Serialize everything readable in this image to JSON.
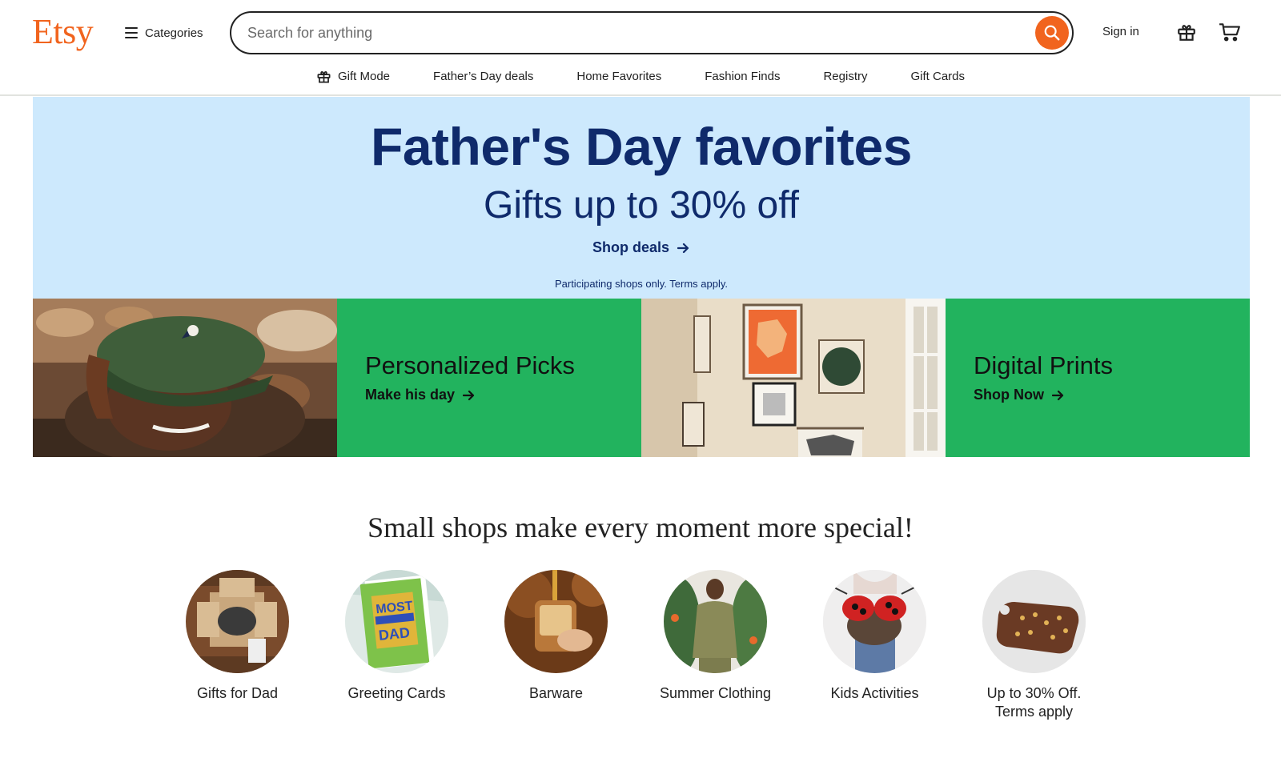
{
  "header": {
    "logo": "Etsy",
    "categories_label": "Categories",
    "search_placeholder": "Search for anything",
    "signin_label": "Sign in",
    "icons": [
      "menu-icon",
      "search-icon",
      "gift-icon",
      "cart-icon"
    ]
  },
  "subnav": {
    "items": [
      {
        "label": "Gift Mode",
        "icon": "gift-icon"
      },
      {
        "label": "Father’s Day deals"
      },
      {
        "label": "Home Favorites"
      },
      {
        "label": "Fashion Finds"
      },
      {
        "label": "Registry"
      },
      {
        "label": "Gift Cards"
      }
    ]
  },
  "hero": {
    "title": "Father's Day favorites",
    "subtitle": "Gifts up to 30% off",
    "link": "Shop deals",
    "note": "Participating shops only. Terms apply."
  },
  "tiles": [
    {
      "title": "Personalized Picks",
      "link": "Make his day"
    },
    {
      "title": "Digital Prints",
      "link": "Shop Now"
    }
  ],
  "section": {
    "title": "Small shops make every moment more special!",
    "items": [
      {
        "label": "Gifts for Dad"
      },
      {
        "label": "Greeting Cards"
      },
      {
        "label": "Barware"
      },
      {
        "label": "Summer Clothing"
      },
      {
        "label": "Kids Activities"
      },
      {
        "label": "Up to 30% Off. Terms apply"
      }
    ]
  },
  "colors": {
    "brand_orange": "#F1641E",
    "hero_bg": "#CDE9FD",
    "hero_text": "#0F2A6B",
    "tile_green": "#22B35E"
  }
}
